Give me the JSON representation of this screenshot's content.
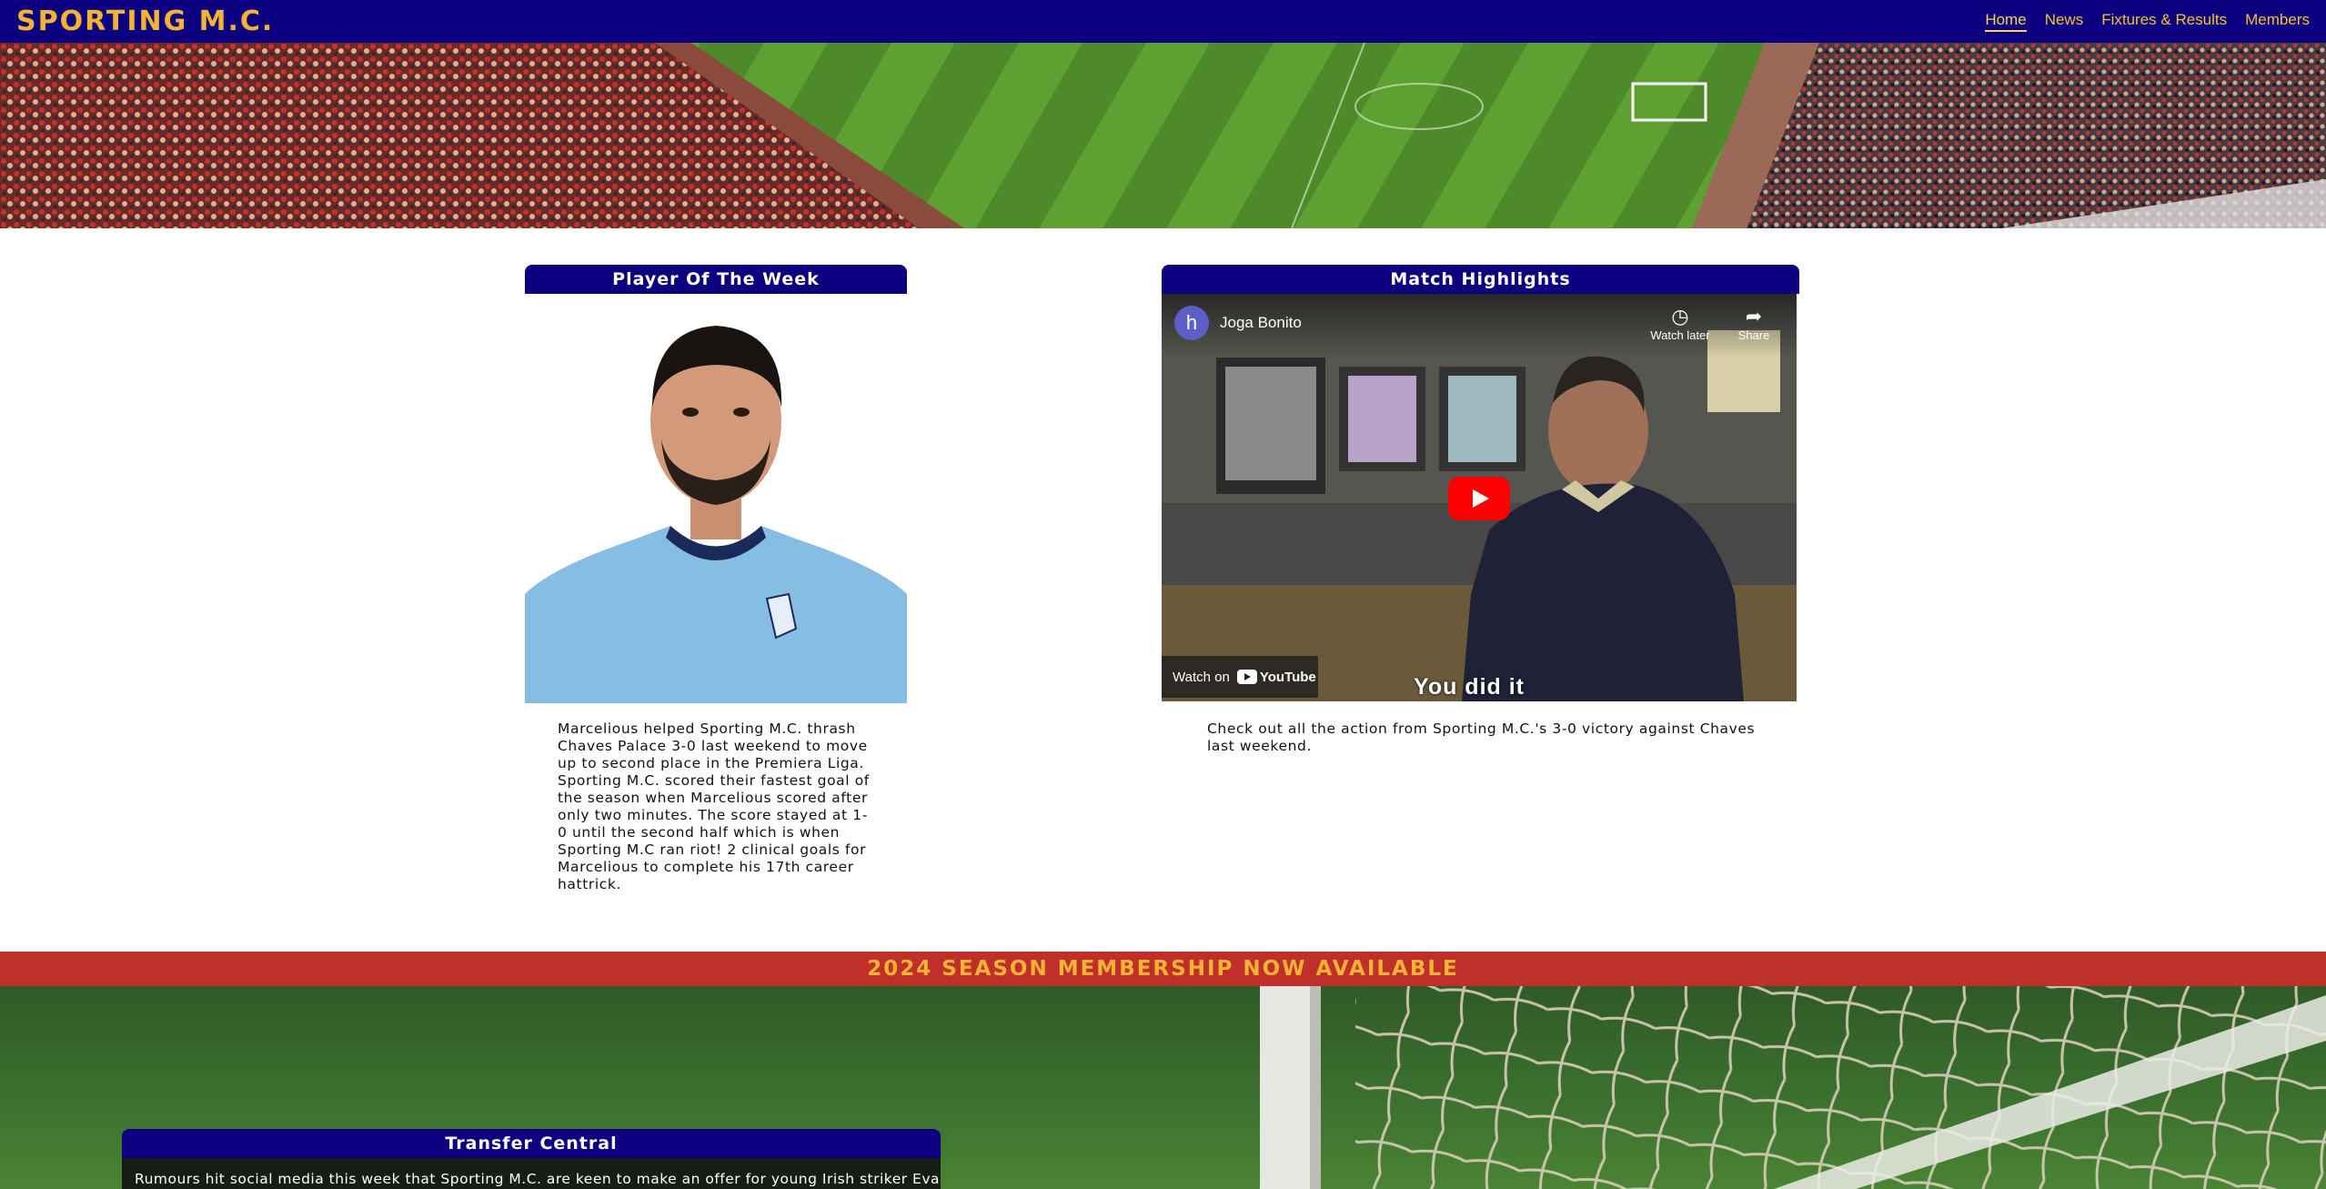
{
  "header": {
    "brand": "SPORTING M.C.",
    "nav": [
      {
        "label": "Home",
        "active": true
      },
      {
        "label": "News",
        "active": false
      },
      {
        "label": "Fixtures & Results",
        "active": false
      },
      {
        "label": "Members",
        "active": false
      }
    ]
  },
  "player_of_week": {
    "title": "Player Of The Week",
    "text": "Marcelious helped Sporting M.C. thrash Chaves Palace 3-0 last weekend to move up to second place in the Premiera Liga. Sporting M.C. scored their fastest goal of the season when Marcelious scored after only two minutes. The score stayed at 1-0 until the second half which is when Sporting M.C ran riot! 2 clinical goals for Marcelious to complete his 17th career hattrick."
  },
  "match_highlights": {
    "title": "Match Highlights",
    "video": {
      "channel_initial": "h",
      "channel_name": "Joga Bonito",
      "watch_later": "Watch later",
      "share": "Share",
      "watch_on": "Watch on",
      "youtube": "YouTube",
      "caption": "You did it"
    },
    "text": "Check out all the action from Sporting M.C.'s 3-0 victory against Chaves last weekend."
  },
  "membership_banner": "2024 SEASON MEMBERSHIP NOW AVAILABLE",
  "transfer_central": {
    "title": "Transfer Central",
    "text": "Rumours hit social media this week that Sporting M.C. are keen to make an offer for young Irish striker Evan"
  },
  "colors": {
    "navy": "#0c0080",
    "gold": "#f2b233",
    "banner_red": "#c0302a"
  }
}
